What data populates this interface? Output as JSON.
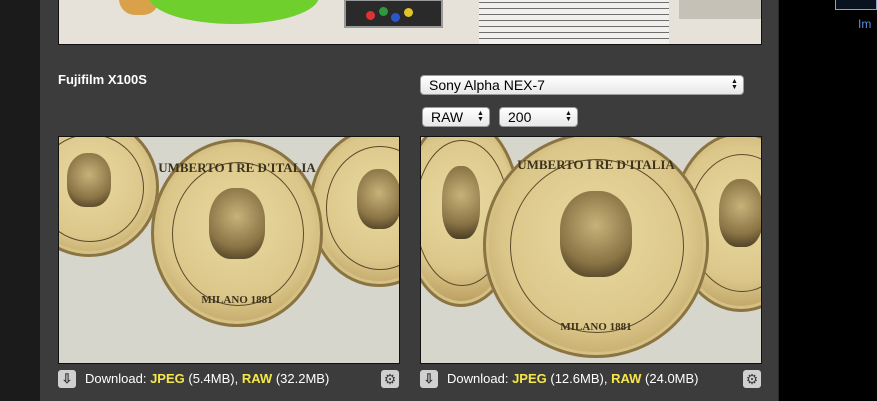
{
  "sidebar": {
    "thumb_label": "Im"
  },
  "left": {
    "camera_name": "Fujifilm X100S",
    "download": {
      "label": "Download:",
      "jpeg_label": "JPEG",
      "jpeg_size": "(5.4MB),",
      "raw_label": "RAW",
      "raw_size": "(32.2MB)"
    }
  },
  "right": {
    "camera_select": "Sony Alpha NEX-7",
    "format_select": "RAW",
    "iso_select": "200",
    "download": {
      "label": "Download:",
      "jpeg_label": "JPEG",
      "jpeg_size": "(12.6MB),",
      "raw_label": "RAW",
      "raw_size": "(24.0MB)"
    }
  },
  "coin": {
    "top_text": "UMBERTO I RE D'ITALIA",
    "bottom_text": "MILANO 1881"
  },
  "icons": {
    "download": "download-icon",
    "settings": "gear-icon"
  },
  "colors": {
    "panel": "#3c3c3c",
    "highlight": "#f6e84a",
    "link": "#5b8fe0"
  }
}
